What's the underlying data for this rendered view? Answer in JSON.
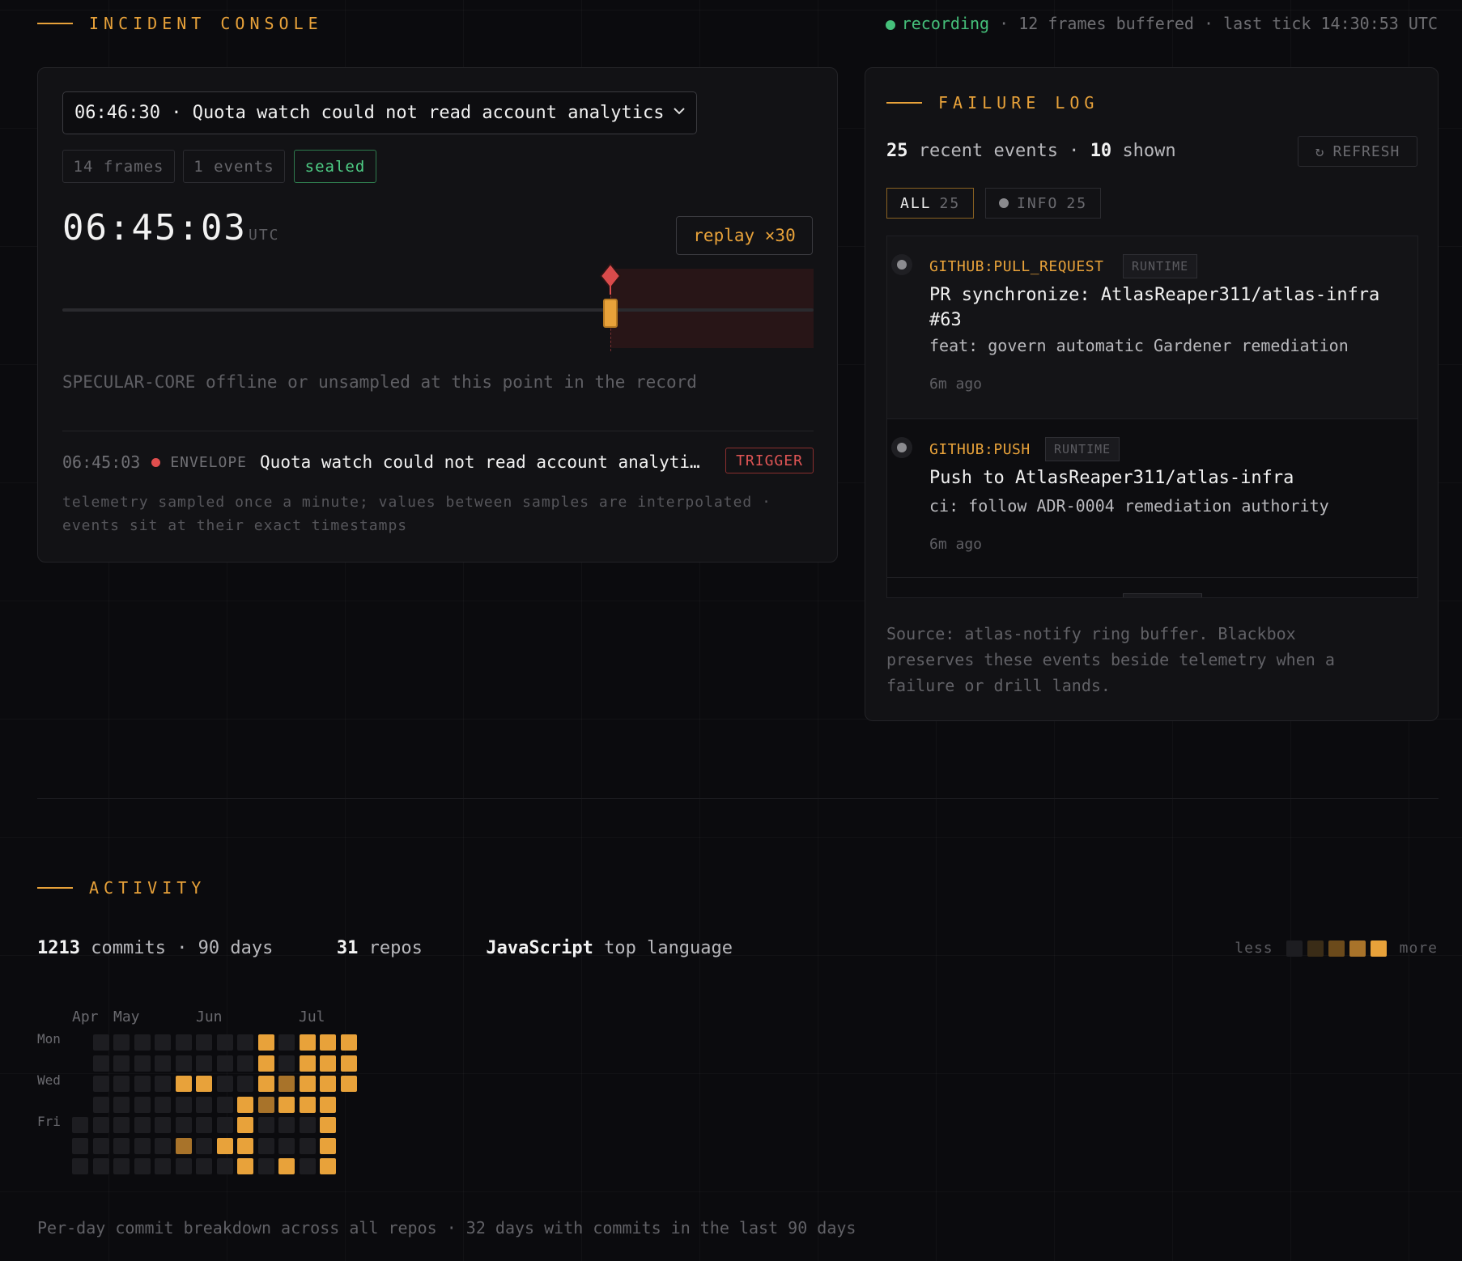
{
  "header": {
    "title": "INCIDENT CONSOLE",
    "status_label": "recording",
    "status_rest": "· 12 frames buffered · last tick 14:30:53 UTC"
  },
  "incident": {
    "selected": "06:46:30 · Quota watch could not read account analytics",
    "chips": [
      "14 frames",
      "1 events",
      "sealed"
    ],
    "clock": "06:45:03",
    "clock_unit": "UTC",
    "replay_label": "replay ×30",
    "progress": 0.73,
    "offline_msg": "SPECULAR-CORE offline or unsampled at this point in the record",
    "event": {
      "time": "06:45:03",
      "kind": "ENVELOPE",
      "text": "Quota watch could not read account analyti…",
      "badge": "TRIGGER"
    },
    "footnote": "telemetry sampled once a minute; values between samples are interpolated · events sit at their exact timestamps"
  },
  "failure_log": {
    "title": "FAILURE LOG",
    "recent_count": "25",
    "recent_label": "recent events ·",
    "shown_count": "10",
    "shown_label": "shown",
    "refresh_label": "REFRESH",
    "tabs": [
      {
        "label": "ALL",
        "count": "25"
      },
      {
        "label": "INFO",
        "count": "25"
      }
    ],
    "items": [
      {
        "source": "GITHUB:PULL_REQUEST",
        "tag": "RUNTIME",
        "title": "PR synchronize: AtlasReaper311/atlas-infra #63",
        "subtitle": "feat: govern automatic Gardener remediation",
        "time": "6m ago"
      },
      {
        "source": "GITHUB:PUSH",
        "tag": "RUNTIME",
        "title": "Push to AtlasReaper311/atlas-infra",
        "subtitle": "ci: follow ADR-0004 remediation authority",
        "time": "6m ago"
      }
    ],
    "source_note": "Source: atlas-notify ring buffer. Blackbox preserves these events beside telemetry when a failure or drill lands."
  },
  "activity": {
    "title": "ACTIVITY",
    "commits": "1213",
    "commits_label": "commits · 90 days",
    "repos": "31",
    "repos_label": "repos",
    "language": "JavaScript",
    "language_label": "top language",
    "legend_less": "less",
    "legend_more": "more",
    "months": [
      "Apr",
      "May",
      "Jun",
      "Jul"
    ],
    "days": [
      "Mon",
      "Wed",
      "Fri"
    ],
    "footer": "Per-day commit breakdown across all repos · 32 days with commits in the last 90 days",
    "levels_colors": [
      "#1d1d21",
      "#3a2c17",
      "#6b4a1b",
      "#a8732a",
      "#e8a23a"
    ],
    "heatmap_weeks": [
      [
        null,
        null,
        null,
        null,
        0,
        0,
        0
      ],
      [
        0,
        0,
        0,
        0,
        0,
        0,
        0
      ],
      [
        0,
        0,
        0,
        0,
        0,
        0,
        0
      ],
      [
        0,
        0,
        0,
        0,
        0,
        0,
        0
      ],
      [
        0,
        0,
        0,
        0,
        0,
        0,
        0
      ],
      [
        0,
        0,
        4,
        0,
        0,
        3,
        0
      ],
      [
        0,
        0,
        4,
        0,
        0,
        0,
        0
      ],
      [
        0,
        0,
        0,
        0,
        0,
        4,
        0
      ],
      [
        0,
        0,
        0,
        4,
        4,
        4,
        4
      ],
      [
        4,
        4,
        4,
        3,
        0,
        0,
        0
      ],
      [
        0,
        0,
        3,
        4,
        0,
        0,
        4
      ],
      [
        4,
        4,
        4,
        4,
        0,
        0,
        0
      ],
      [
        4,
        4,
        4,
        4,
        4,
        4,
        4
      ],
      [
        4,
        4,
        4,
        null,
        null,
        null,
        null
      ]
    ]
  }
}
